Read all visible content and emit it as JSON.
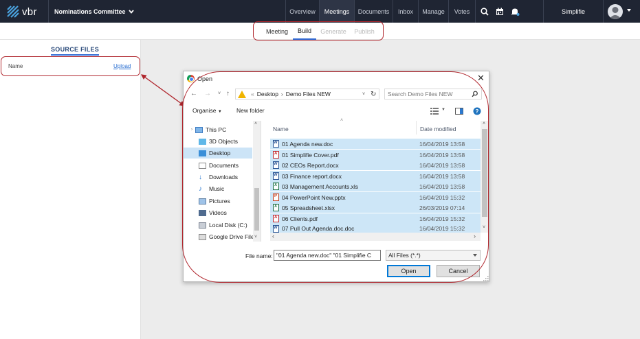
{
  "topbar": {
    "logo_text": "vbr",
    "committee": "Nominations Committee",
    "nav": [
      "Overview",
      "Meetings",
      "Documents",
      "Inbox",
      "Manage",
      "Votes"
    ],
    "active_nav": "Meetings",
    "account": "Simplifie",
    "icons": [
      "search-icon",
      "calendar-icon",
      "bell-icon",
      "avatar"
    ]
  },
  "subnav": {
    "tabs": [
      "Meeting",
      "Build",
      "Generate",
      "Publish"
    ],
    "active": "Build",
    "disabled": [
      "Generate",
      "Publish"
    ]
  },
  "sidebar": {
    "title": "SOURCE FILES",
    "name_label": "Name",
    "upload_label": "Upload"
  },
  "dialog": {
    "title": "Open",
    "breadcrumb": [
      "Desktop",
      "Demo Files NEW"
    ],
    "search_placeholder": "Search Demo Files NEW",
    "organise": "Organise",
    "new_folder": "New folder",
    "tree": [
      "This PC",
      "3D Objects",
      "Desktop",
      "Documents",
      "Downloads",
      "Music",
      "Pictures",
      "Videos",
      "Local Disk (C:)",
      "Google Drive File"
    ],
    "selected_tree": "Desktop",
    "columns": {
      "name": "Name",
      "date": "Date modified"
    },
    "files": [
      {
        "name": "01 Agenda new.doc",
        "date": "16/04/2019 13:58",
        "type": "word"
      },
      {
        "name": "01 Simplifie Cover.pdf",
        "date": "16/04/2019 13:58",
        "type": "pdf"
      },
      {
        "name": "02 CEOs Report.docx",
        "date": "16/04/2019 13:58",
        "type": "word"
      },
      {
        "name": "03 Finance report.docx",
        "date": "16/04/2019 13:58",
        "type": "word"
      },
      {
        "name": "03 Management Accounts.xls",
        "date": "16/04/2019 13:58",
        "type": "excel"
      },
      {
        "name": "04 PowerPoint New.pptx",
        "date": "16/04/2019 15:32",
        "type": "ppt"
      },
      {
        "name": "05 Spreadsheet.xlsx",
        "date": "26/03/2019 07:14",
        "type": "excel"
      },
      {
        "name": "06 Clients.pdf",
        "date": "16/04/2019 15:32",
        "type": "pdf"
      },
      {
        "name": "07 Pull Out Agenda.doc.doc",
        "date": "16/04/2019 15:32",
        "type": "word"
      }
    ],
    "file_name_label": "File name:",
    "file_name_value": "\"01 Agenda new.doc\" \"01 Simplifie C",
    "file_type": "All Files (*.*)",
    "open_button": "Open",
    "cancel_button": "Cancel"
  },
  "colors": {
    "topbar_bg": "#1f2533",
    "accent": "#2f6bd6",
    "annotation": "#b0262d",
    "selection": "#cde6f7"
  }
}
